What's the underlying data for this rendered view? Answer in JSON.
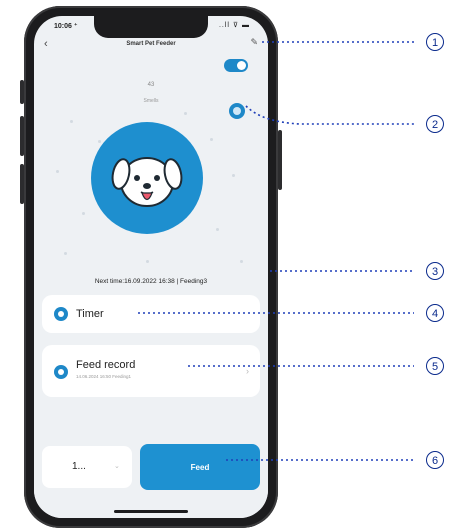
{
  "status_bar": {
    "time": "10:06 ⁺",
    "icons": "..ll ⊽ ▬"
  },
  "header": {
    "back_glyph": "‹",
    "title": "Smart Pet Feeder",
    "edit_glyph": "✎"
  },
  "reading": {
    "value": "43",
    "unit": "Smells"
  },
  "next_time_text": "Next time:16.09.2022 16:38 | Feeding3",
  "timer_card": {
    "label": "Timer"
  },
  "record_card": {
    "label": "Feed record",
    "subtitle": "14.06.2024 16:50 Feeding1",
    "chevron": "›"
  },
  "quantity": {
    "value": "1...",
    "arrow": "⌄"
  },
  "feed_button": {
    "label": "Feed"
  },
  "callouts": [
    "1",
    "2",
    "3",
    "4",
    "5",
    "6"
  ],
  "colors": {
    "accent": "#1e88c8",
    "callout": "#0a2a8c",
    "screen_bg": "#eef1f4"
  }
}
